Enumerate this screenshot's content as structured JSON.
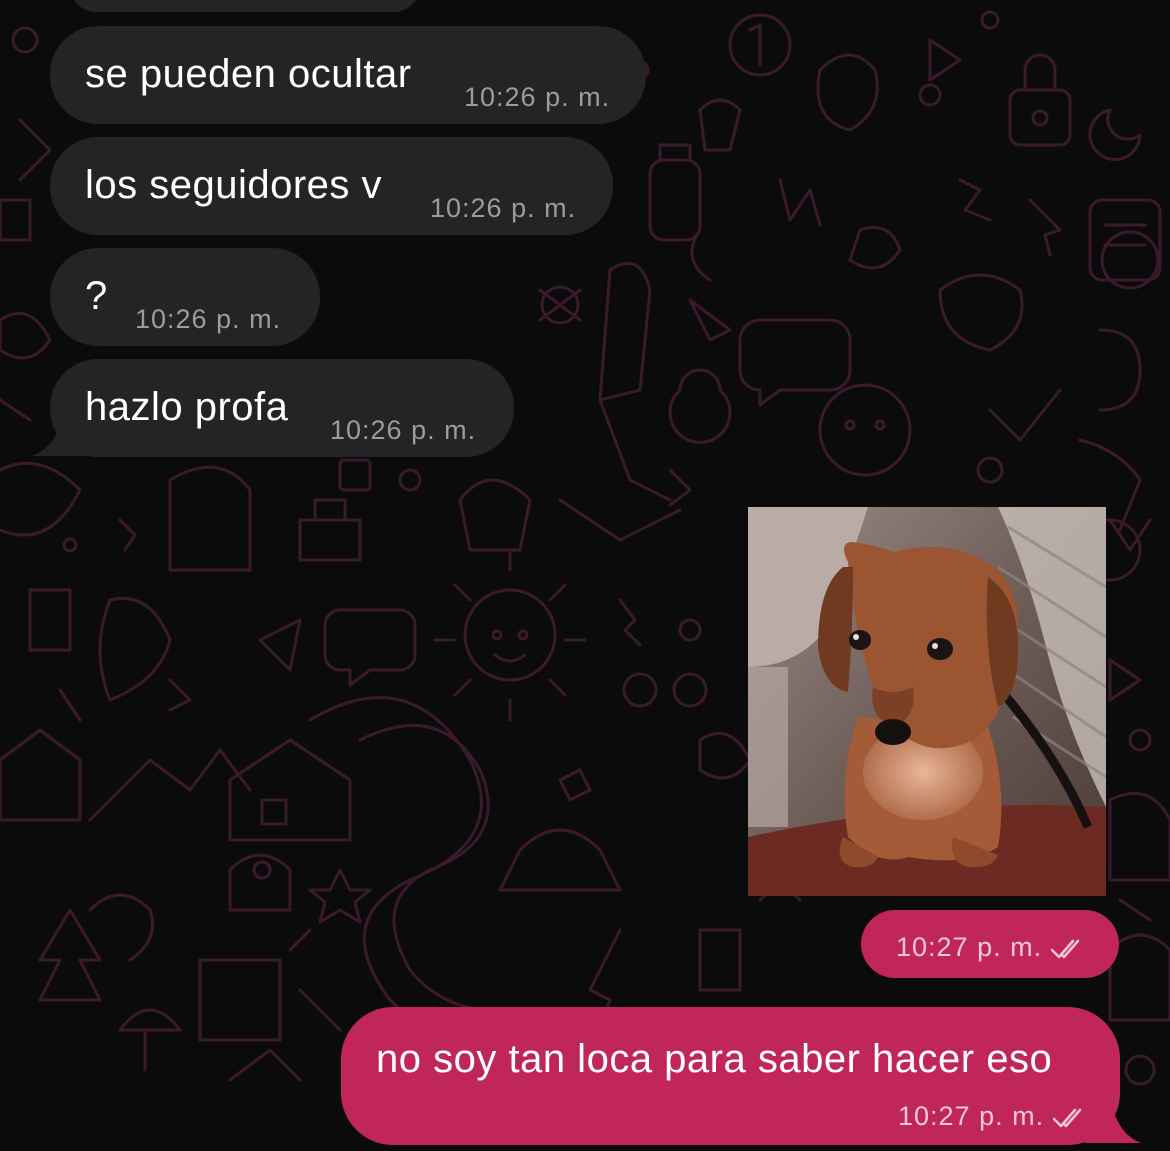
{
  "chat": {
    "messages": [
      {
        "direction": "incoming",
        "text": "se pueden ocultar",
        "time": "10:26 p. m."
      },
      {
        "direction": "incoming",
        "text": "los seguidores v",
        "time": "10:26 p. m."
      },
      {
        "direction": "incoming",
        "text": "?",
        "time": "10:26 p. m."
      },
      {
        "direction": "incoming",
        "text": "hazlo profa",
        "time": "10:26 p. m."
      },
      {
        "direction": "outgoing",
        "type": "image",
        "image_subject": "dachshund-puppy",
        "time": "10:27 p. m.",
        "status": "read"
      },
      {
        "direction": "outgoing",
        "text": "no soy tan loca para saber hacer eso",
        "time": "10:27 p. m.",
        "status": "read"
      }
    ]
  },
  "theme": {
    "background": "#0b0b0c",
    "doodle_color": "#3a1a2c",
    "incoming_bubble": "#232425",
    "outgoing_bubble": "#c0265c",
    "icons": [
      "double-check-icon"
    ]
  }
}
